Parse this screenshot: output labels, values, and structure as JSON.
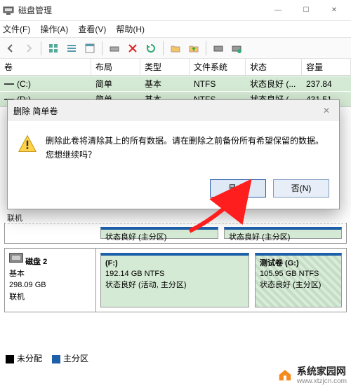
{
  "window": {
    "title": "磁盘管理",
    "minimize": "—",
    "maximize": "☐",
    "close": "✕"
  },
  "menu": {
    "file": "文件(F)",
    "action": "操作(A)",
    "view": "查看(V)",
    "help": "帮助(H)"
  },
  "columns": {
    "volume": "卷",
    "layout": "布局",
    "type": "类型",
    "fs": "文件系统",
    "status": "状态",
    "capacity": "容量"
  },
  "volumes": [
    {
      "name": "(C:)",
      "layout": "简单",
      "type": "基本",
      "fs": "NTFS",
      "status": "状态良好 (...",
      "capacity": "237.84"
    },
    {
      "name": "(D:)",
      "layout": "简单",
      "type": "基本",
      "fs": "NTFS",
      "status": "状态良好 (...",
      "capacity": "431.51"
    }
  ],
  "dialog": {
    "title": "删除 简单卷",
    "message": "删除此卷将清除其上的所有数据。请在删除之前备份所有希望保留的数据。您想继续吗？",
    "yes": "是(Y)",
    "no": "否(N)",
    "closeIcon": "✕"
  },
  "diskPartHealthy": "状态良好 (主分区)",
  "online": "联机",
  "disk2": {
    "name": "磁盘 2",
    "type": "基本",
    "size": "298.09 GB",
    "online": "联机",
    "p1": {
      "label": "(F:)",
      "size": "192.14 GB NTFS",
      "status": "状态良好 (活动, 主分区)"
    },
    "p2": {
      "label": "测试卷   (G:)",
      "size": "105.95 GB NTFS",
      "status": "状态良好 (主分区)"
    }
  },
  "legend": {
    "unalloc": "未分配",
    "primary": "主分区"
  },
  "watermark": {
    "name": "系统家园网",
    "url": "www.xtzjcn.com"
  }
}
